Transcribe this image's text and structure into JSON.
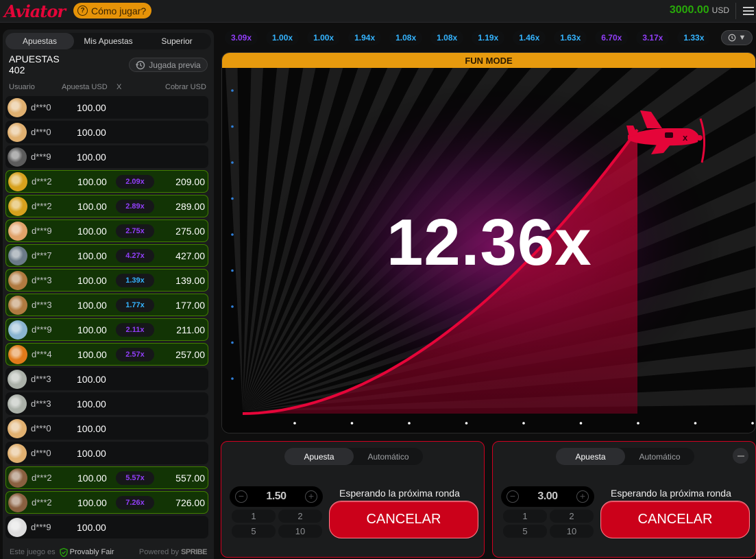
{
  "header": {
    "logo": "Aviator",
    "how_to_play": "Cómo jugar?",
    "balance": "3000.00",
    "currency": "USD"
  },
  "left_panel": {
    "tabs": [
      "Apuestas",
      "Mis Apuestas",
      "Superior"
    ],
    "active_tab": "Apuestas",
    "bets_label": "APUESTAS",
    "bets_count": "402",
    "previous_round": "Jugada previa",
    "columns": {
      "user": "Usuario",
      "bet": "Apuesta USD",
      "x": "X",
      "cashout": "Cobrar USD"
    },
    "rows": [
      {
        "user": "d***0",
        "bet": "100.00",
        "mult": "",
        "cashout": "",
        "win": false,
        "avatar": "#e0b070",
        "mult_color": ""
      },
      {
        "user": "d***0",
        "bet": "100.00",
        "mult": "",
        "cashout": "",
        "win": false,
        "avatar": "#e0b070",
        "mult_color": ""
      },
      {
        "user": "d***9",
        "bet": "100.00",
        "mult": "",
        "cashout": "",
        "win": false,
        "avatar": "#5c5c5c",
        "mult_color": ""
      },
      {
        "user": "d***2",
        "bet": "100.00",
        "mult": "2.09x",
        "cashout": "209.00",
        "win": true,
        "avatar": "#d7a11d",
        "mult_color": "#913ef8"
      },
      {
        "user": "d***2",
        "bet": "100.00",
        "mult": "2.89x",
        "cashout": "289.00",
        "win": true,
        "avatar": "#d7a11d",
        "mult_color": "#913ef8"
      },
      {
        "user": "d***9",
        "bet": "100.00",
        "mult": "2.75x",
        "cashout": "275.00",
        "win": true,
        "avatar": "#e0a26a",
        "mult_color": "#913ef8"
      },
      {
        "user": "d***7",
        "bet": "100.00",
        "mult": "4.27x",
        "cashout": "427.00",
        "win": true,
        "avatar": "#6b7a88",
        "mult_color": "#913ef8"
      },
      {
        "user": "d***3",
        "bet": "100.00",
        "mult": "1.39x",
        "cashout": "139.00",
        "win": true,
        "avatar": "#b07a40",
        "mult_color": "#34b4ff"
      },
      {
        "user": "d***3",
        "bet": "100.00",
        "mult": "1.77x",
        "cashout": "177.00",
        "win": true,
        "avatar": "#b07a40",
        "mult_color": "#34b4ff"
      },
      {
        "user": "d***9",
        "bet": "100.00",
        "mult": "2.11x",
        "cashout": "211.00",
        "win": true,
        "avatar": "#8ab4d0",
        "mult_color": "#913ef8"
      },
      {
        "user": "d***4",
        "bet": "100.00",
        "mult": "2.57x",
        "cashout": "257.00",
        "win": true,
        "avatar": "#e07a1a",
        "mult_color": "#913ef8"
      },
      {
        "user": "d***3",
        "bet": "100.00",
        "mult": "",
        "cashout": "",
        "win": false,
        "avatar": "#aab0a8",
        "mult_color": ""
      },
      {
        "user": "d***3",
        "bet": "100.00",
        "mult": "",
        "cashout": "",
        "win": false,
        "avatar": "#aab0a8",
        "mult_color": ""
      },
      {
        "user": "d***0",
        "bet": "100.00",
        "mult": "",
        "cashout": "",
        "win": false,
        "avatar": "#e0b070",
        "mult_color": ""
      },
      {
        "user": "d***0",
        "bet": "100.00",
        "mult": "",
        "cashout": "",
        "win": false,
        "avatar": "#e0b070",
        "mult_color": ""
      },
      {
        "user": "d***2",
        "bet": "100.00",
        "mult": "5.57x",
        "cashout": "557.00",
        "win": true,
        "avatar": "#8a6040",
        "mult_color": "#913ef8"
      },
      {
        "user": "d***2",
        "bet": "100.00",
        "mult": "7.26x",
        "cashout": "726.00",
        "win": true,
        "avatar": "#8a6040",
        "mult_color": "#913ef8"
      },
      {
        "user": "d***9",
        "bet": "100.00",
        "mult": "",
        "cashout": "",
        "win": false,
        "avatar": "#dddddd",
        "mult_color": ""
      }
    ],
    "footer": {
      "game_is": "Este juego es",
      "provably_fair": "Provably Fair",
      "powered_by": "Powered by",
      "brand": "SPRIBE"
    }
  },
  "history": [
    {
      "v": "3.09x",
      "c": "#913ef8"
    },
    {
      "v": "1.00x",
      "c": "#34b4ff"
    },
    {
      "v": "1.00x",
      "c": "#34b4ff"
    },
    {
      "v": "1.94x",
      "c": "#34b4ff"
    },
    {
      "v": "1.08x",
      "c": "#34b4ff"
    },
    {
      "v": "1.08x",
      "c": "#34b4ff"
    },
    {
      "v": "1.19x",
      "c": "#34b4ff"
    },
    {
      "v": "1.46x",
      "c": "#34b4ff"
    },
    {
      "v": "1.63x",
      "c": "#34b4ff"
    },
    {
      "v": "6.70x",
      "c": "#913ef8"
    },
    {
      "v": "3.17x",
      "c": "#913ef8"
    },
    {
      "v": "1.33x",
      "c": "#34b4ff"
    }
  ],
  "game": {
    "mode_banner": "FUN MODE",
    "multiplier": "12.36x",
    "accent": "#e50539"
  },
  "bet_panels": [
    {
      "tab_bet": "Apuesta",
      "tab_auto": "Automático",
      "amount": "1.50",
      "quick": [
        "1",
        "2",
        "5",
        "10"
      ],
      "waiting": "Esperando la próxima ronda",
      "cancel": "CANCELAR"
    },
    {
      "tab_bet": "Apuesta",
      "tab_auto": "Automático",
      "amount": "3.00",
      "quick": [
        "1",
        "2",
        "5",
        "10"
      ],
      "waiting": "Esperando la próxima ronda",
      "cancel": "CANCELAR"
    }
  ]
}
